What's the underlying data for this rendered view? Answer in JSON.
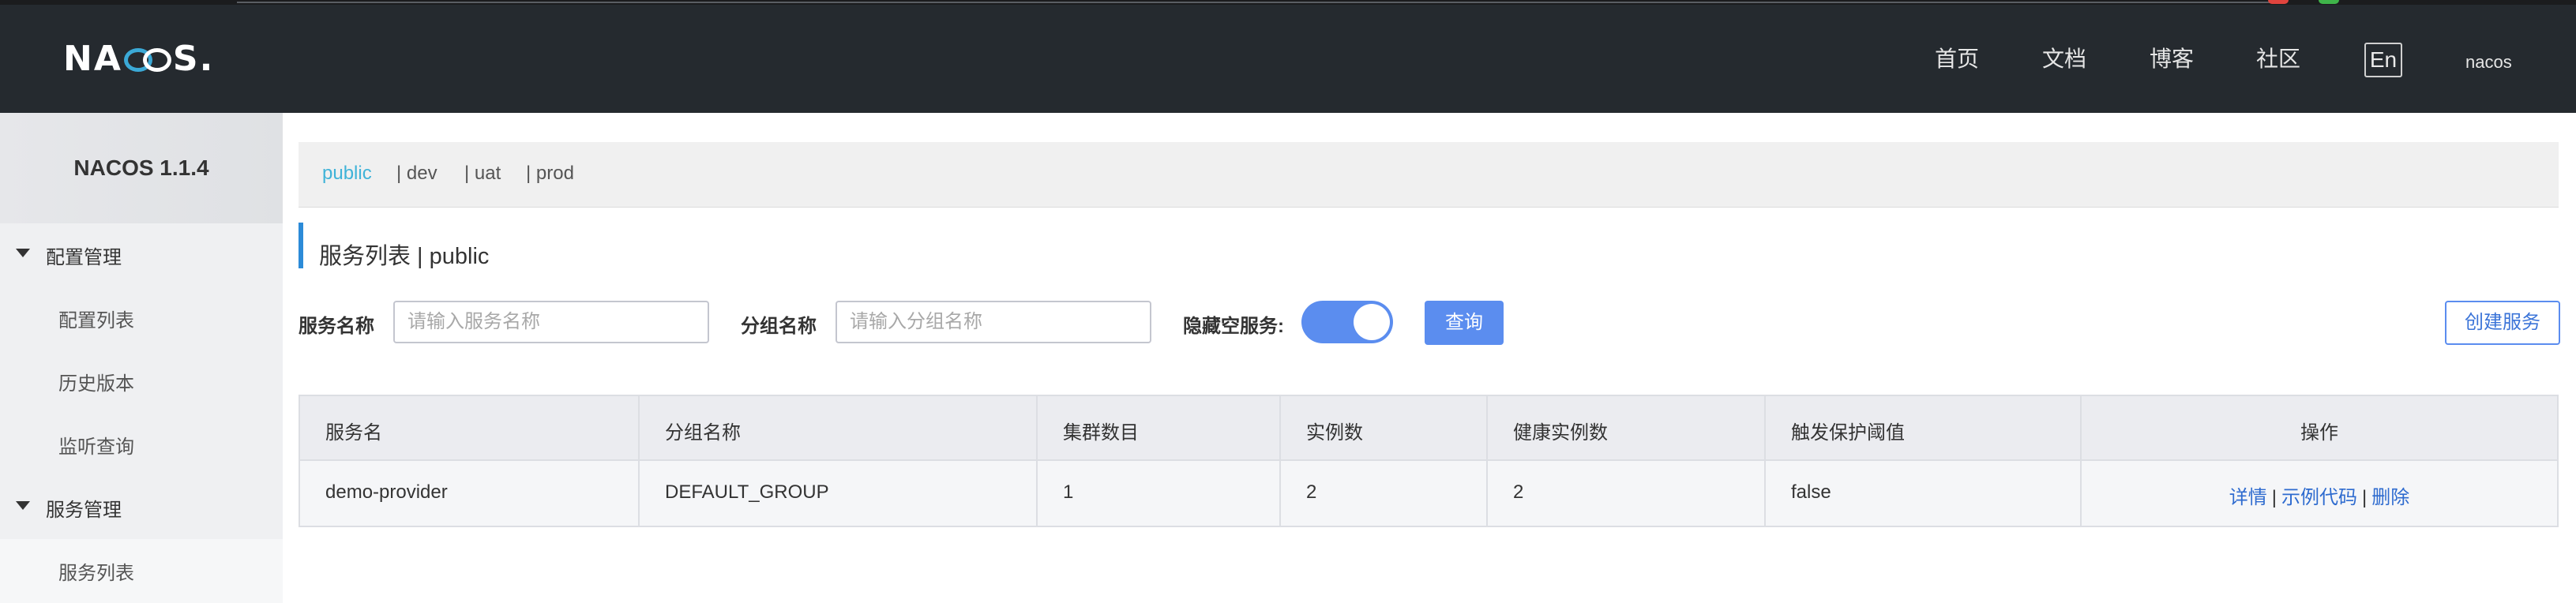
{
  "header": {
    "logo": {
      "part1": "NA",
      "part2": "S",
      "dot": "."
    },
    "nav": [
      "首页",
      "文档",
      "博客",
      "社区"
    ],
    "lang_button": "En",
    "user": "nacos"
  },
  "sidebar": {
    "title": "NACOS 1.1.4",
    "groups": [
      {
        "label": "配置管理",
        "items": [
          "配置列表",
          "历史版本",
          "监听查询"
        ]
      },
      {
        "label": "服务管理",
        "items": [
          "服务列表"
        ]
      }
    ]
  },
  "namespaces": {
    "items": [
      "public",
      "| dev",
      "| uat",
      "| prod"
    ],
    "active": "public"
  },
  "page": {
    "title": "服务列表 | public"
  },
  "filters": {
    "service_name_label": "服务名称",
    "service_name_placeholder": "请输入服务名称",
    "group_name_label": "分组名称",
    "group_name_placeholder": "请输入分组名称",
    "hide_empty_label": "隐藏空服务:",
    "hide_empty_on": true,
    "query_button": "查询",
    "create_button": "创建服务"
  },
  "table": {
    "columns": [
      "服务名",
      "分组名称",
      "集群数目",
      "实例数",
      "健康实例数",
      "触发保护阈值",
      "操作"
    ],
    "rows": [
      {
        "service_name": "demo-provider",
        "group_name": "DEFAULT_GROUP",
        "cluster_count": "1",
        "instance_count": "2",
        "healthy_count": "2",
        "protect_threshold": "false",
        "actions": [
          "详情",
          "示例代码",
          "删除"
        ]
      }
    ],
    "action_separator": "|"
  },
  "colors": {
    "header_bg": "#252a2f",
    "accent_blue": "#5b8def",
    "namespace_active": "#3fb3d8",
    "link": "#2e6bcf"
  }
}
